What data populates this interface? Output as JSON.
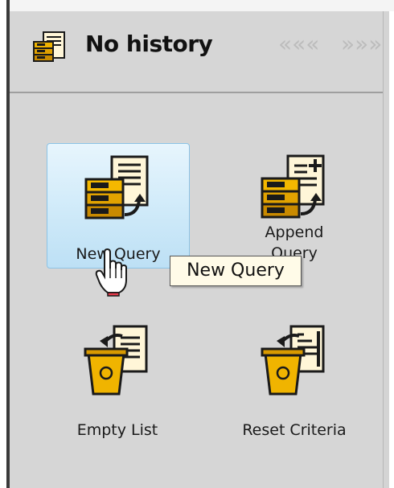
{
  "header": {
    "title": "No history",
    "back_glyph": "«««",
    "forward_glyph": "»»»",
    "icon": "query-history-icon"
  },
  "actions": [
    {
      "label_line1": "New Query",
      "label_line2": "",
      "icon": "new-query-icon",
      "selected": true
    },
    {
      "label_line1": "Append",
      "label_line2": "Query",
      "icon": "append-query-icon",
      "selected": false
    },
    {
      "label_line1": "Empty List",
      "label_line2": "",
      "icon": "empty-list-icon",
      "selected": false
    },
    {
      "label_line1": "Reset Criteria",
      "label_line2": "",
      "icon": "reset-criteria-icon",
      "selected": false
    }
  ],
  "tooltip": {
    "text": "New Query"
  },
  "colors": {
    "panel": "#d6d6d6",
    "selected_tile": "#cfeaf9",
    "tooltip_bg": "#fffbe8",
    "icon_gold": "#e8a800"
  }
}
